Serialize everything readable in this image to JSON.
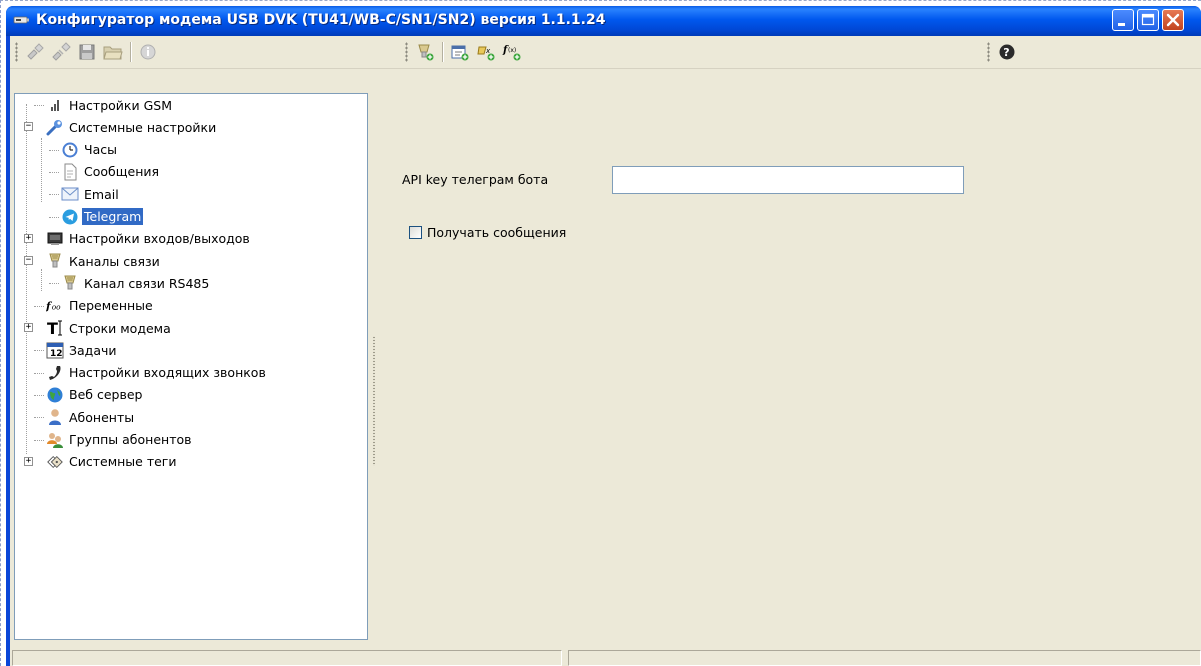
{
  "window": {
    "title": "Конфигуратор модема USB DVK (TU41/WB-C/SN1/SN2)  версия 1.1.1.24"
  },
  "toolbar": {
    "groups": [
      {
        "buttons": [
          "connect-icon",
          "disconnect-icon",
          "save-icon",
          "open-folder-icon",
          "info-icon"
        ]
      },
      {
        "buttons": [
          "add-channel-icon",
          "add-task-icon",
          "add-variable-icon",
          "add-function-icon"
        ]
      },
      {
        "buttons": [
          "help-icon"
        ]
      }
    ]
  },
  "tree": {
    "items": [
      {
        "label": "Настройки GSM",
        "icon": "signal-bars-icon",
        "level": 0,
        "expander": ""
      },
      {
        "label": "Системные настройки",
        "icon": "wrench-icon",
        "level": 0,
        "expander": "−"
      },
      {
        "label": "Часы",
        "icon": "clock-icon",
        "level": 1,
        "expander": ""
      },
      {
        "label": "Сообщения",
        "icon": "document-icon",
        "level": 1,
        "expander": ""
      },
      {
        "label": "Email",
        "icon": "envelope-icon",
        "level": 1,
        "expander": ""
      },
      {
        "label": "Telegram",
        "icon": "telegram-icon",
        "level": 1,
        "expander": "",
        "selected": true
      },
      {
        "label": "Настройки входов/выходов",
        "icon": "io-board-icon",
        "level": 0,
        "expander": "+"
      },
      {
        "label": "Каналы связи",
        "icon": "channel-icon",
        "level": 0,
        "expander": "−"
      },
      {
        "label": "Канал связи RS485",
        "icon": "channel-icon",
        "level": 1,
        "expander": ""
      },
      {
        "label": "Переменные",
        "icon": "function-icon",
        "level": 0,
        "expander": ""
      },
      {
        "label": "Строки модема",
        "icon": "text-cursor-icon",
        "level": 0,
        "expander": "+"
      },
      {
        "label": "Задачи",
        "icon": "calendar-icon",
        "level": 0,
        "expander": ""
      },
      {
        "label": "Настройки входящих звонков",
        "icon": "phone-icon",
        "level": 0,
        "expander": ""
      },
      {
        "label": "Веб сервер",
        "icon": "globe-icon",
        "level": 0,
        "expander": ""
      },
      {
        "label": "Абоненты",
        "icon": "user-icon",
        "level": 0,
        "expander": ""
      },
      {
        "label": "Группы абонентов",
        "icon": "users-group-icon",
        "level": 0,
        "expander": ""
      },
      {
        "label": "Системные теги",
        "icon": "tags-icon",
        "level": 0,
        "expander": "+"
      }
    ],
    "calendar_day": "12",
    "function_glyph": "f(x)"
  },
  "content": {
    "api_key_label": "API key телеграм бота",
    "api_key_value": "",
    "receive_messages_label": "Получать сообщения",
    "receive_messages_checked": false
  },
  "colors": {
    "titlebar": "#0058ee",
    "client_bg": "#ece9d8",
    "selection": "#316ac5",
    "close_button": "#c2421e"
  }
}
